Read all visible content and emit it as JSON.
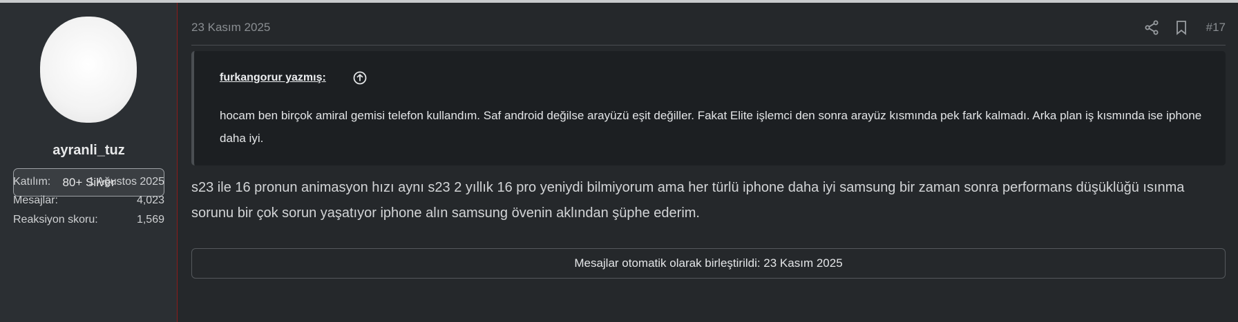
{
  "user": {
    "name": "ayranli_tuz",
    "badge": "80+ Silver",
    "stats": [
      {
        "label": "Katılım:",
        "value": "1 Ağustos 2025"
      },
      {
        "label": "Mesajlar:",
        "value": "4,023"
      },
      {
        "label": "Reaksiyon skoru:",
        "value": "1,569"
      }
    ]
  },
  "post": {
    "date": "23 Kasım 2025",
    "number": "#17",
    "icons": [
      "share-icon",
      "bookmark-icon"
    ],
    "quote": {
      "author": "furkangorur yazmış:",
      "text": "hocam ben birçok amiral gemisi telefon kullandım. Saf android değilse arayüzü eşit değiller. Fakat Elite işlemci den sonra arayüz kısmında pek fark kalmadı. Arka plan iş kısmında ise iphone daha iyi."
    },
    "message": "s23 ile 16 pronun animasyon hızı aynı s23 2 yıllık 16 pro yeniydi bilmiyorum ama her türlü iphone daha iyi samsung bir zaman sonra performans düşüklüğü ısınma sorunu bir çok sorun yaşatıyor iphone alın samsung övenin aklından şüphe ederim.",
    "merge_notice": "Mesajlar otomatik olarak birleştirildi: 23 Kasım 2025"
  },
  "colors": {
    "background": "#25282b",
    "sidebar": "#2b2f33",
    "accent_divider": "#8b1c1c",
    "quote_bg": "#1c1f22"
  }
}
